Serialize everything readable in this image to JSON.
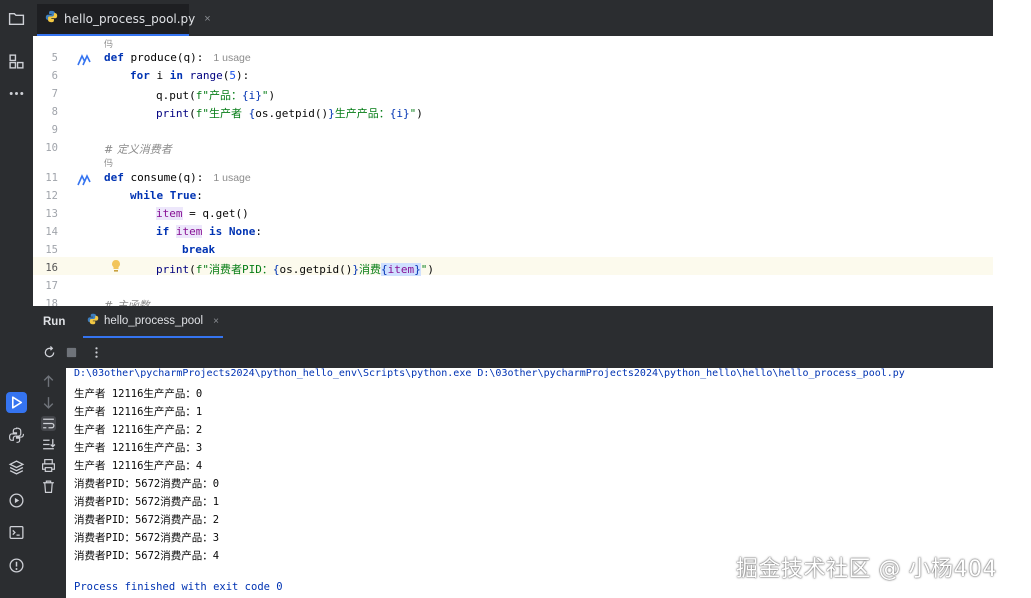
{
  "editor_tab": {
    "filename": "hello_process_pool.py",
    "close": "×",
    "icon": "python-file-icon"
  },
  "code_lines": [
    {
      "ln": "5",
      "text": "def produce(q):"
    },
    {
      "ln": "6",
      "text": "for i in range(5):"
    },
    {
      "ln": "7",
      "text": "q.put(f\"产品：{i}\")"
    },
    {
      "ln": "8",
      "text": "print(f\"生产者 {os.getpid()}生产产品：{i}\")"
    },
    {
      "ln": "9",
      "text": ""
    },
    {
      "ln": "10",
      "text": "# 定义消费者"
    },
    {
      "ln": "11",
      "text": "def consume(q):"
    },
    {
      "ln": "12",
      "text": "while True:"
    },
    {
      "ln": "13",
      "text": "item = q.get()"
    },
    {
      "ln": "14",
      "text": "if item is None:"
    },
    {
      "ln": "15",
      "text": "break"
    },
    {
      "ln": "16",
      "text": "print(f\"消费者PID：{os.getpid()}消费{item}\")"
    },
    {
      "ln": "17",
      "text": ""
    },
    {
      "ln": "18",
      "text": "# 主函数"
    }
  ],
  "inlay_hints": {
    "produce_usage": "1 usage",
    "consume_usage": "1 usage"
  },
  "author_mark": "㐷",
  "run_panel": {
    "title": "Run",
    "tab_label": "hello_process_pool",
    "close": "×"
  },
  "console": {
    "command": "D:\\03other\\pycharmProjects2024\\python_hello_env\\Scripts\\python.exe D:\\03other\\pycharmProjects2024\\python_hello\\hello\\hello_process_pool.py",
    "lines": [
      "生产者 12116生产产品：0",
      "生产者 12116生产产品：1",
      "生产者 12116生产产品：2",
      "生产者 12116生产产品：3",
      "生产者 12116生产产品：4",
      "消费者PID：5672消费产品：0",
      "消费者PID：5672消费产品：1",
      "消费者PID：5672消费产品：2",
      "消费者PID：5672消费产品：3",
      "消费者PID：5672消费产品：4"
    ],
    "exit": "Process finished with exit code 0"
  },
  "watermark": "掘金技术社区 @ 小杨404",
  "colors": {
    "accent": "#3574f0",
    "dark_bg": "#2b2d30",
    "keyword": "#0033b3",
    "string": "#067d17",
    "variable": "#871094"
  }
}
